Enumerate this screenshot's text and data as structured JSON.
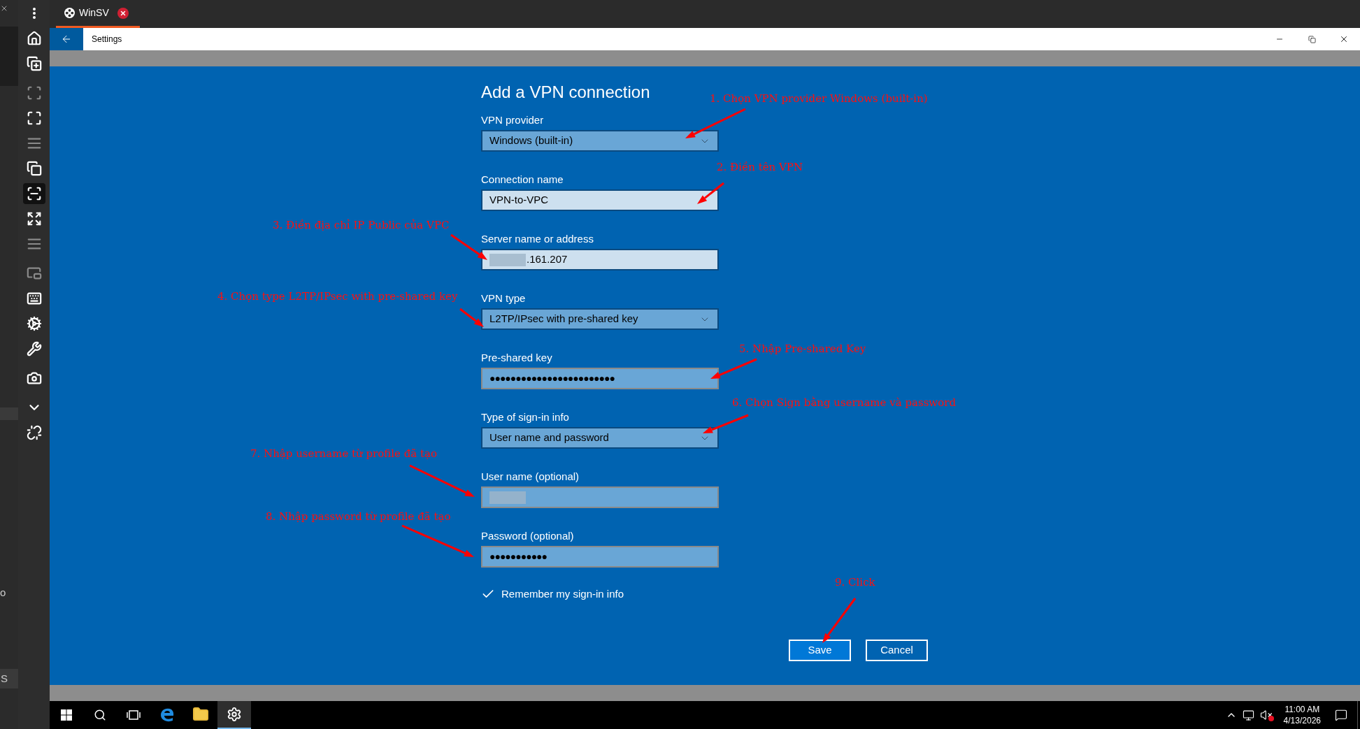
{
  "edge_strip": {
    "fragments": [
      "o",
      "S"
    ]
  },
  "toolbar_groups": [
    [
      {
        "kind": "dots",
        "selected": false,
        "disabled": false
      },
      {
        "kind": "home",
        "selected": false,
        "disabled": false
      },
      {
        "kind": "new-window",
        "selected": false,
        "disabled": false
      }
    ],
    [
      {
        "kind": "frame",
        "selected": false,
        "disabled": true
      },
      {
        "kind": "corners",
        "selected": false,
        "disabled": false
      },
      {
        "kind": "lines",
        "selected": false,
        "disabled": true
      },
      {
        "kind": "windows",
        "selected": false,
        "disabled": false
      },
      {
        "kind": "fit",
        "selected": true,
        "disabled": false
      },
      {
        "kind": "expand",
        "selected": false,
        "disabled": false
      },
      {
        "kind": "lines",
        "selected": false,
        "disabled": true
      }
    ],
    [
      {
        "kind": "pip",
        "selected": false,
        "disabled": true
      },
      {
        "kind": "keyboard",
        "selected": false,
        "disabled": false
      },
      {
        "kind": "gears",
        "selected": false,
        "disabled": false
      },
      {
        "kind": "wrench",
        "selected": false,
        "disabled": false
      }
    ],
    [
      {
        "kind": "camera",
        "selected": false,
        "disabled": false
      }
    ],
    [
      {
        "kind": "chevron",
        "selected": false,
        "disabled": false
      },
      {
        "kind": "unlink",
        "selected": false,
        "disabled": false
      }
    ]
  ],
  "app_tab": {
    "title": "WinSV",
    "selected": true
  },
  "window": {
    "title": "Settings"
  },
  "page": {
    "title": "Add a VPN connection",
    "fields": [
      {
        "kind": "dropdown",
        "label": "VPN provider",
        "value": "Windows (built-in)"
      },
      {
        "kind": "text",
        "label": "Connection name",
        "value": "VPN-to-VPC"
      },
      {
        "kind": "text",
        "label": "Server name or address",
        "value": ".161.207",
        "redacted": true
      },
      {
        "kind": "dropdown",
        "label": "VPN type",
        "value": "L2TP/IPsec with pre-shared key"
      },
      {
        "kind": "password",
        "label": "Pre-shared key",
        "value": "●●●●●●●●●●●●●●●●●●●●●●●●"
      },
      {
        "kind": "dropdown",
        "label": "Type of sign-in info",
        "value": "User name and password"
      },
      {
        "kind": "blurred",
        "label": "User name (optional)",
        "redacted": true
      },
      {
        "kind": "password",
        "label": "Password (optional)",
        "value": "●●●●●●●●●●●"
      }
    ],
    "checkbox": {
      "label": "Remember my sign-in info",
      "checked": true
    },
    "buttons": [
      {
        "label": "Save",
        "primary": true
      },
      {
        "label": "Cancel",
        "primary": false
      }
    ]
  },
  "annotations": [
    "1. Chọn VPN provider Windows (built-in)",
    "2. Điền tên VPN",
    "3. Điền địa chỉ IP Public của VPC",
    "4. Chọn type L2TP/IPsec with pre-shared key",
    "5. Nhập Pre-shared Key",
    "6. Chọn Sign bằng username và password",
    "7. Nhập username từ profile đã tạo",
    "8. Nhập password từ profile đã tạo",
    "9. Click"
  ],
  "taskbar": {
    "apps": [
      {
        "kind": "browser",
        "selected": false
      },
      {
        "kind": "folder",
        "selected": false
      },
      {
        "kind": "settings",
        "selected": true
      }
    ],
    "time": "11:00 AM",
    "date": "4/13/2026"
  }
}
